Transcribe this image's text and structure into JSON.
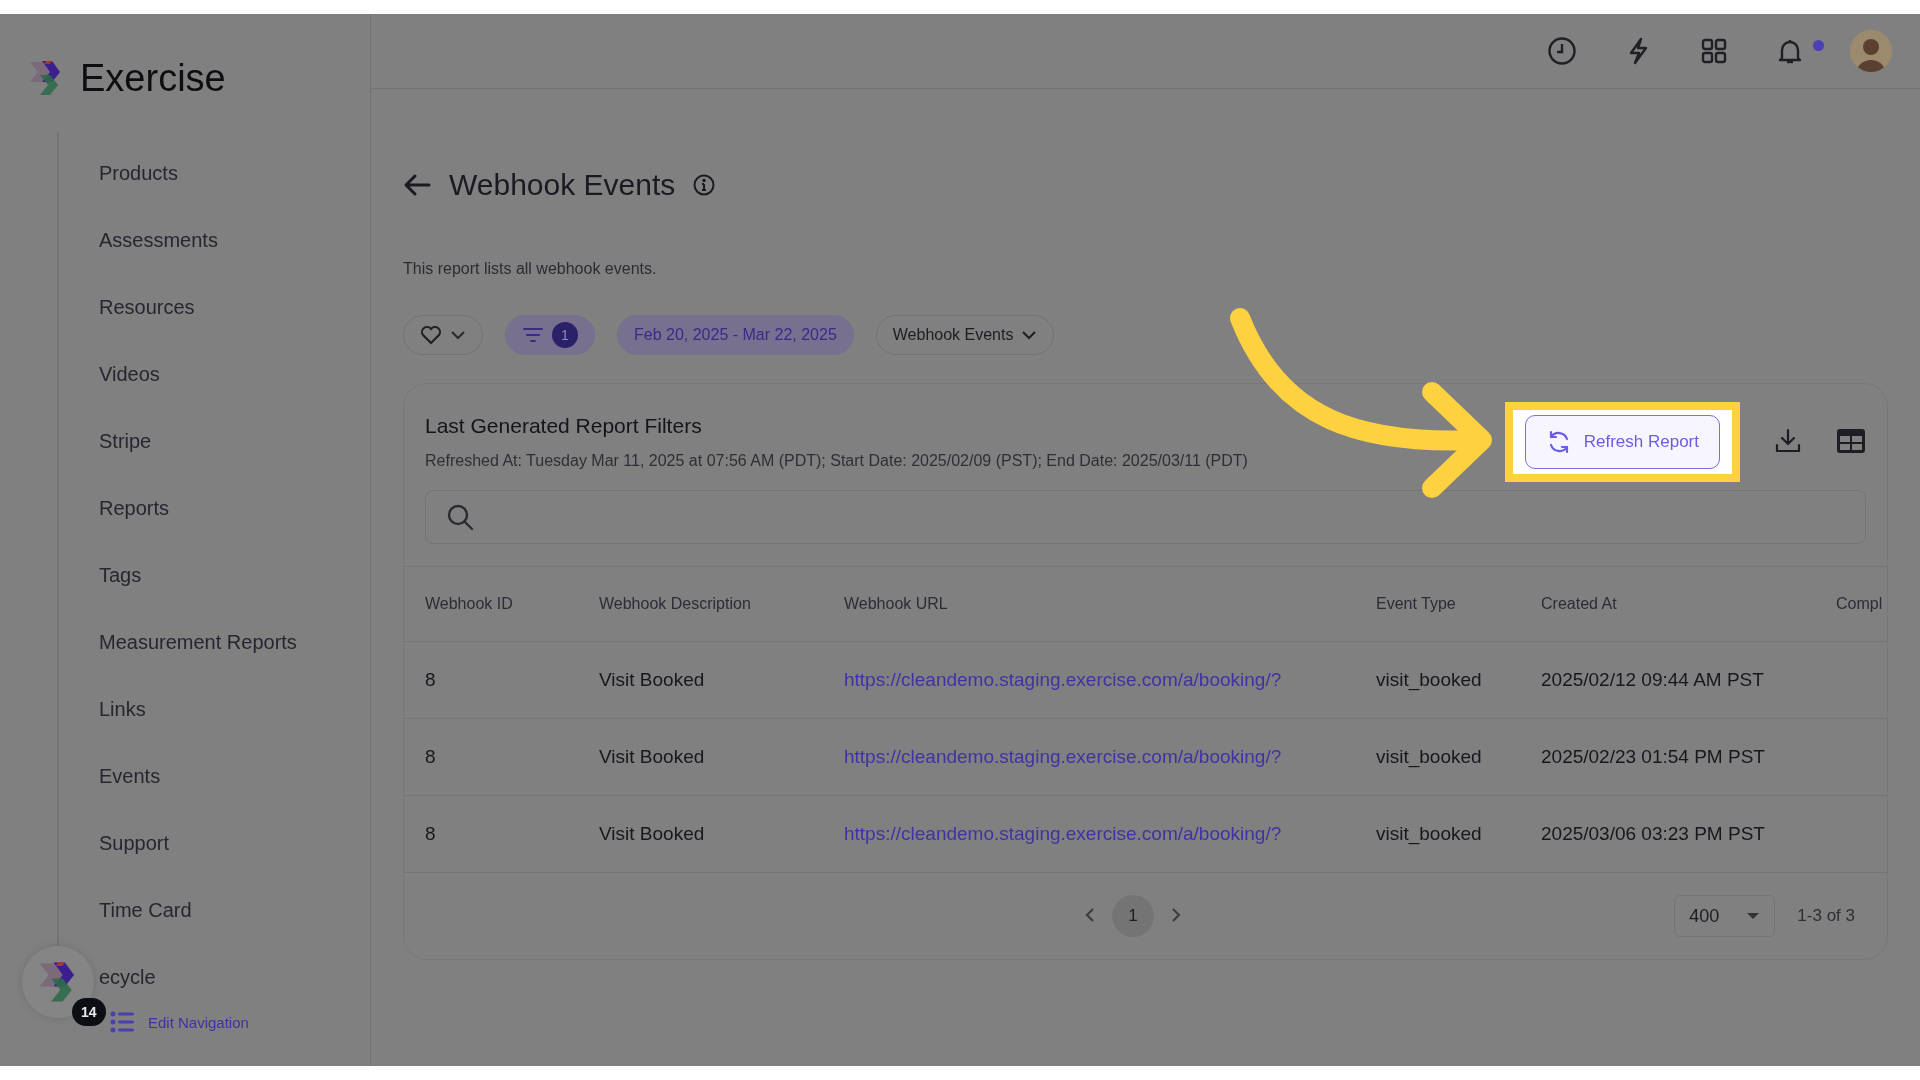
{
  "topbar": {
    "notification_unread": true
  },
  "sidebar": {
    "logo": "Exercise",
    "items": [
      {
        "label": "Products"
      },
      {
        "label": "Assessments"
      },
      {
        "label": "Resources"
      },
      {
        "label": "Videos"
      },
      {
        "label": "Stripe"
      },
      {
        "label": "Reports"
      },
      {
        "label": "Tags"
      },
      {
        "label": "Measurement Reports"
      },
      {
        "label": "Links"
      },
      {
        "label": "Events"
      },
      {
        "label": "Support"
      },
      {
        "label": "Time Card"
      },
      {
        "label": "ecycle"
      }
    ],
    "chat_badge": "14",
    "edit_link": "Edit Navigation"
  },
  "page": {
    "title": "Webhook Events",
    "description": "This report lists all webhook events."
  },
  "filters": {
    "filter_count": "1",
    "date_range": "Feb 20, 2025 - Mar 22, 2025",
    "report_type": "Webhook Events"
  },
  "card": {
    "title": "Last Generated Report Filters",
    "refreshed": "Refreshed At: Tuesday Mar 11, 2025 at 07:56 AM (PDT); Start Date: 2025/02/09 (PST); End Date: 2025/03/11 (PDT)",
    "refresh_button": "Refresh Report",
    "highlighted": true
  },
  "table": {
    "columns": [
      "Webhook ID",
      "Webhook Description",
      "Webhook URL",
      "Event Type",
      "Created At",
      "Compl"
    ],
    "rows": [
      [
        "8",
        "Visit Booked",
        "https://cleandemo.staging.exercise.com/a/booking/?",
        "visit_booked",
        "2025/02/12 09:44 AM PST"
      ],
      [
        "8",
        "Visit Booked",
        "https://cleandemo.staging.exercise.com/a/booking/?",
        "visit_booked",
        "2025/02/23 01:54 PM PST"
      ],
      [
        "8",
        "Visit Booked",
        "https://cleandemo.staging.exercise.com/a/booking/?",
        "visit_booked",
        "2025/03/06 03:23 PM PST"
      ]
    ]
  },
  "pagination": {
    "pages": [
      {
        "label": "1",
        "selected": true
      }
    ],
    "page_size": "400",
    "range": "1-3 of 3"
  }
}
